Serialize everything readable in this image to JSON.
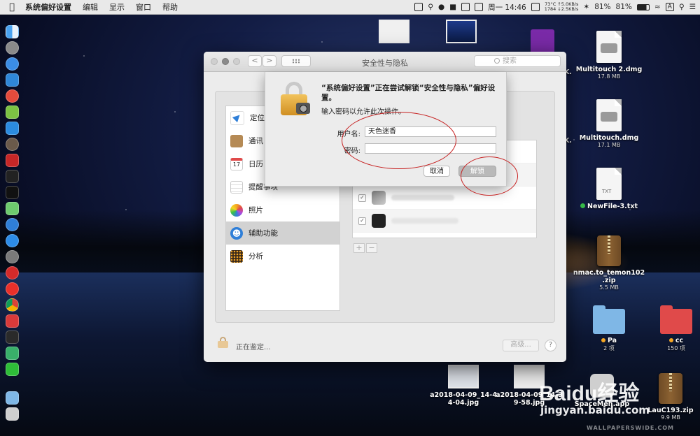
{
  "menubar": {
    "app_name": "系统偏好设置",
    "items": [
      "编辑",
      "显示",
      "窗口",
      "帮助"
    ],
    "clock": "周一 14:46",
    "temp_line1": "73°C",
    "temp_line2": "1784",
    "net_up": "5.0KB/s",
    "net_down": "2.5KB/s",
    "battery1": "81%",
    "battery2": "81%",
    "input_method": "A"
  },
  "window": {
    "title": "安全性与隐私",
    "search_placeholder": "搜索",
    "back": "<",
    "forward": ">",
    "categories": [
      "定位",
      "通讯",
      "日历",
      "提醒事项",
      "照片",
      "辅助功能",
      "分析"
    ],
    "selected_category": "辅助功能",
    "calendar_day": "17",
    "plus": "+",
    "minus": "−",
    "lock_status": "正在鉴定...",
    "advanced_label": "高级...",
    "help_label": "?",
    "checked_mark": "✓"
  },
  "auth_dialog": {
    "message": "“系统偏好设置”正在尝试解锁“安全性与隐私”偏好设置。",
    "instruction": "输入密码以允许此次操作。",
    "username_label": "用户名:",
    "username_value": "天色迷香",
    "password_label": "密码:",
    "password_value": "",
    "cancel_label": "取消",
    "unlock_label": "解锁"
  },
  "desktop": {
    "truncated_labels": [
      "K.",
      "K."
    ],
    "files": [
      {
        "name": "Multitouch 2.dmg",
        "size": "17.8 MB"
      },
      {
        "name": "Multitouch.dmg",
        "size": "17.1 MB"
      },
      {
        "name": "NewFile-3.txt",
        "ext": "TXT"
      },
      {
        "name_line1": "nmac.to_temon102",
        "name_line2": ".zip",
        "size": "5.5 MB"
      },
      {
        "name": "Pa",
        "sub": "2 项"
      },
      {
        "name": "cc",
        "sub": "150 项"
      },
      {
        "name_line1": "a2018-04-09_14-4",
        "name_line2": "4-04.jpg"
      },
      {
        "name_line1": "a2018-04-09_14-3",
        "name_line2": "9-58.jpg"
      },
      {
        "name": "SpaceMeh.app"
      },
      {
        "name": "LauC193.zip",
        "size": "9.9 MB"
      }
    ]
  },
  "watermark": {
    "brand": "Baidu经验",
    "url": "jingyan.baidu.com",
    "wallpaper": "WALLPAPERSWIDE.COM"
  },
  "colors": {
    "accent_red": "#c62020",
    "folder_blue": "#7fb7e6",
    "folder_red": "#e04a4a",
    "tag_orange": "#f5a623",
    "tag_green": "#38c14b"
  }
}
